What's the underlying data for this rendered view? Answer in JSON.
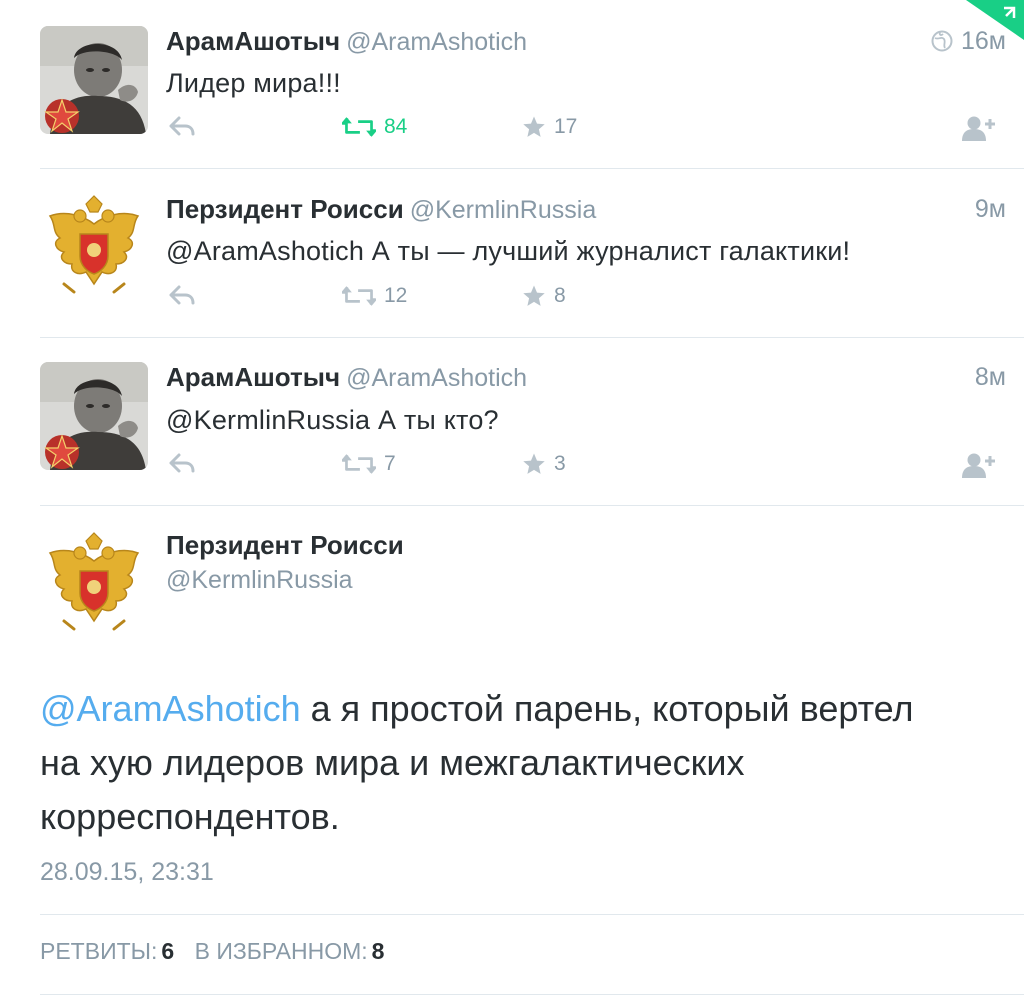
{
  "colors": {
    "text": "#292f33",
    "muted": "#8899a6",
    "link": "#55acee",
    "retweet_active": "#19cf86",
    "divider": "#e1e8ed"
  },
  "tweets": [
    {
      "name": "АрамАшотыч",
      "handle": "@AramAshotich",
      "time": "16м",
      "text": "Лидер мира!!!",
      "retweets": "84",
      "favorites": "17",
      "avatar": "man-photo-with-star-avatar"
    },
    {
      "name": "Перзидент Роисси",
      "handle": "@KermlinRussia",
      "time": "9м",
      "text": "@AramAshotich А ты — лучший журналист галактики!",
      "retweets": "12",
      "favorites": "8",
      "avatar": "russian-coat-of-arms-avatar"
    },
    {
      "name": "АрамАшотыч",
      "handle": "@AramAshotich",
      "time": "8м",
      "text": "@KermlinRussia А ты кто?",
      "retweets": "7",
      "favorites": "3",
      "avatar": "man-photo-with-star-avatar"
    }
  ],
  "detail": {
    "name": "Перзидент Роисси",
    "handle": "@KermlinRussia",
    "mention": "@AramAshotich",
    "text_line1": "а я простой парень, который вертел",
    "text_line2": "на хую лидеров мира и межгалактических",
    "text_line3": "корреспондентов.",
    "date": "28.09.15, 23:31",
    "retweets_label": "РЕТВИТЫ:",
    "retweets_count": "6",
    "favorites_label": "В ИЗБРАННОМ:",
    "favorites_count": "8"
  }
}
